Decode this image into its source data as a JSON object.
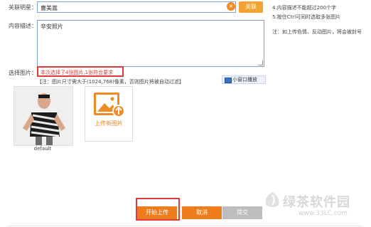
{
  "form": {
    "star_label": "关联明星：",
    "star_value": "曹美嵩",
    "clear_icon": "×",
    "link_button": "关联",
    "desc_label": "内容描述：",
    "desc_value": "辛安照片",
    "select_label": "选择图片：",
    "select_status": "本次选择了4张图片,1张符合要求",
    "size_note": "【注：图片尺寸需大于(1024,768)像素，否则图片将被自动过滤】",
    "popup_button": "小窗口播放",
    "photo_caption": "default",
    "upload_label": "上传新图片"
  },
  "tips": {
    "desc_limit": "4.内容描述不能超过200个字",
    "multi_select": "5.按住Ctrl可同时选取多张图片",
    "note": "注：如上传色情、反动图片，将会被封号"
  },
  "actions": {
    "start_upload": "开始上传",
    "cancel": "取消",
    "submit": "提交"
  },
  "watermark": {
    "brand": "绿茶软件园",
    "url": "www.33LC.com"
  },
  "colors": {
    "accent": "#ef7d1e",
    "highlight_border": "#e03a3a",
    "field_border": "#7ba4d6",
    "disabled": "#bdbdbd"
  }
}
